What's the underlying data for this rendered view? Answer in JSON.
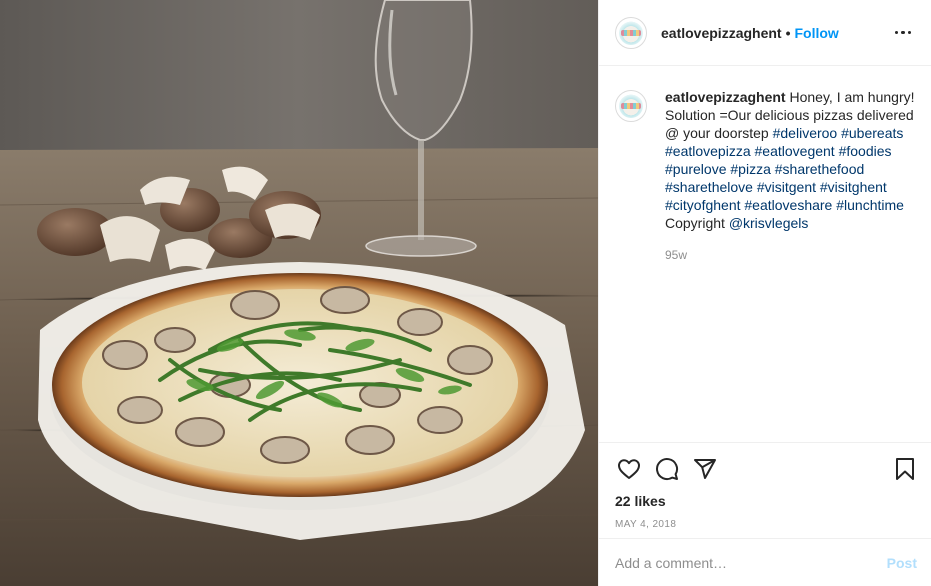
{
  "post": {
    "username": "eatlovepizzaghent",
    "follow_label": "Follow",
    "dot": "•",
    "image_alt": "White pizza with mushrooms and arugula on paper, with a wine glass and mushrooms in the background"
  },
  "caption": {
    "username": "eatlovepizzaghent",
    "parts": [
      {
        "text": " Honey, I am hungry! Solution =Our delicious pizzas delivered @ your doorstep ",
        "tag": false
      },
      {
        "text": "#deliveroo",
        "tag": true
      },
      {
        "text": " ",
        "tag": false
      },
      {
        "text": "#ubereats",
        "tag": true
      },
      {
        "text": " ",
        "tag": false
      },
      {
        "text": "#eatlovepizza",
        "tag": true
      },
      {
        "text": " ",
        "tag": false
      },
      {
        "text": "#eatlovegent",
        "tag": true
      },
      {
        "text": " ",
        "tag": false
      },
      {
        "text": "#foodies",
        "tag": true
      },
      {
        "text": " ",
        "tag": false
      },
      {
        "text": "#purelove",
        "tag": true
      },
      {
        "text": " ",
        "tag": false
      },
      {
        "text": "#pizza",
        "tag": true
      },
      {
        "text": " ",
        "tag": false
      },
      {
        "text": "#sharethefood",
        "tag": true
      },
      {
        "text": " ",
        "tag": false
      },
      {
        "text": "#sharethelove",
        "tag": true
      },
      {
        "text": " ",
        "tag": false
      },
      {
        "text": "#visitgent",
        "tag": true
      },
      {
        "text": " ",
        "tag": false
      },
      {
        "text": "#visitghent",
        "tag": true
      },
      {
        "text": " ",
        "tag": false
      },
      {
        "text": "#cityofghent",
        "tag": true
      },
      {
        "text": " ",
        "tag": false
      },
      {
        "text": "#eatloveshare",
        "tag": true
      },
      {
        "text": " ",
        "tag": false
      },
      {
        "text": "#lunchtime",
        "tag": true
      },
      {
        "text": " Copyright ",
        "tag": false
      },
      {
        "text": "@krisvlegels",
        "tag": true
      }
    ],
    "time_ago": "95w"
  },
  "actions": {
    "like_icon": "heart-icon",
    "comment_icon": "comment-bubble-icon",
    "share_icon": "paper-plane-icon",
    "save_icon": "bookmark-icon",
    "likes_text": "22 likes",
    "date": "MAY 4, 2018"
  },
  "comment": {
    "placeholder": "Add a comment…",
    "post_label": "Post"
  },
  "colors": {
    "accent": "#0095f6",
    "hashtag": "#00376b",
    "post_disabled": "#b2dffc",
    "muted": "#8e8e8e"
  }
}
